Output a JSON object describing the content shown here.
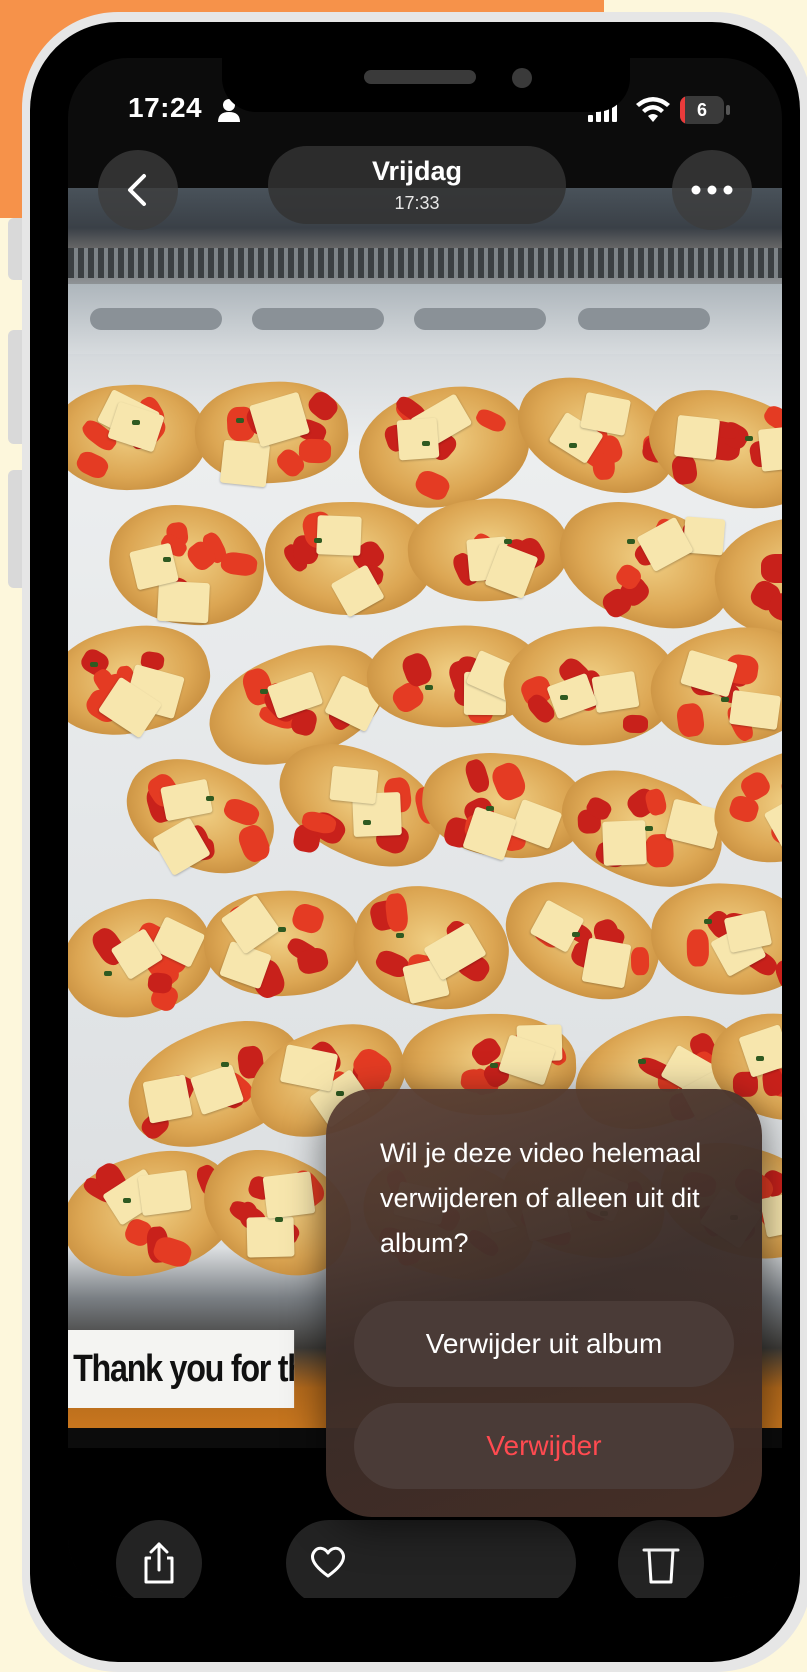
{
  "status_bar": {
    "time": "17:24",
    "battery": "6",
    "battery_level": 0.06
  },
  "header": {
    "title": "Vrijdag",
    "subtitle": "17:33"
  },
  "video": {
    "caption": "Thank you for th"
  },
  "dialog": {
    "message": "Wil je deze video helemaal verwijderen of alleen uit dit album?",
    "remove_from_album": "Verwijder uit album",
    "delete": "Verwijder"
  },
  "icons": {
    "back": "chevron-left-icon",
    "more": "ellipsis-icon",
    "share": "share-icon",
    "favorite": "heart-icon",
    "play": "play-icon",
    "delete": "trash-icon"
  },
  "colors": {
    "background": "#fdf7dc",
    "accent_orange": "#f6924a",
    "danger": "#ff4a50",
    "battery_low": "#ea3b3b"
  }
}
